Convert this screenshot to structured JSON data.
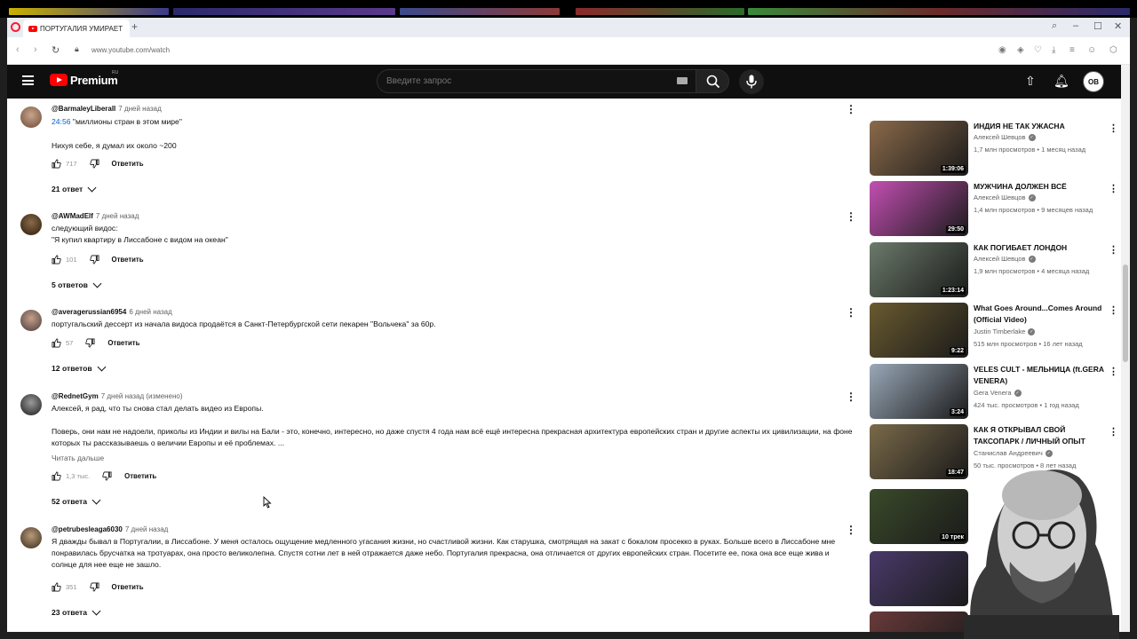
{
  "browser": {
    "tab_title": "ПОРТУГАЛИЯ УМИРАЕТ",
    "new_tab": "+",
    "url": "www.youtube.com/watch"
  },
  "header": {
    "logo_text": "Premium",
    "region": "RU",
    "search_placeholder": "Введите запрос",
    "avatar_initials": "ОВ"
  },
  "comments": [
    {
      "author": "@BarmaleyLiberall",
      "time": "7 дней назад",
      "timestamp": "24:56",
      "line1": " \"миллионы стран в этом мире\"",
      "line2": "Нихуя себе, я думал их около ~200",
      "likes": "717",
      "reply": "Ответить",
      "replies": "21 ответ"
    },
    {
      "author": "@AWMadElf",
      "time": "7 дней назад",
      "text": "следующий видос:\n\"Я купил квартиру в Лиссабоне с видом на океан\"",
      "likes": "101",
      "reply": "Ответить",
      "replies": "5 ответов"
    },
    {
      "author": "@averagerussian6954",
      "time": "6 дней назад",
      "text": "португальский дессерт из начала видоса продаётся в Санкт-Петербургской сети пекарен \"Вольчека\" за 60р.",
      "likes": "57",
      "reply": "Ответить",
      "replies": "12 ответов"
    },
    {
      "author": "@RednetGym",
      "time": "7 дней назад (изменено)",
      "text": "Алексей, я рад, что ты снова стал делать видео из Европы.\n\nПоверь, они нам не надоели, приколы из Индии и вилы на Бали - это, конечно, интересно, но даже спустя 4 года нам всё ещё интересна прекрасная архитектура европейских стран и другие аспекты их цивилизации, на фоне которых ты рассказываешь о величии Европы и её проблемах. ...",
      "more": "Читать дальше",
      "likes": "1,3 тыс.",
      "reply": "Ответить",
      "replies": "52 ответа"
    },
    {
      "author": "@petrubesleaga6030",
      "time": "7 дней назад",
      "text": "Я дважды бывал в Португалии, в Лиссабоне. У меня осталось ощущение медленного угасания жизни, но счастливой жизни. Как старушка, смотрящая на закат с бокалом просекко в руках. Больше всего в Лиссабоне мне понравилась брусчатка на тротуарах, она просто великолепна. Спустя сотни лет в ней отражается даже небо. Португалия прекрасна, она отличается от других европейских стран. Посетите ее, пока она все еще жива и солнце для нее еще не зашло.",
      "likes": "351",
      "reply": "Ответить",
      "replies": "23 ответа"
    }
  ],
  "recommended": [
    {
      "title": "ИНДИЯ НЕ ТАК УЖАСНА",
      "channel": "Алексей Шевцов",
      "meta": "1,7 млн просмотров • 1 месяц назад",
      "duration": "1:39:06",
      "color": "#8a6a4a"
    },
    {
      "title": "МУЖЧИНА ДОЛЖЕН ВСЁ",
      "channel": "Алексей Шевцов",
      "meta": "1,4 млн просмотров • 9 месяцев назад",
      "duration": "29:50",
      "color": "#c34fb2"
    },
    {
      "title": "КАК ПОГИБАЕТ ЛОНДОН",
      "channel": "Алексей Шевцов",
      "meta": "1,9 млн просмотров • 4 месяца назад",
      "duration": "1:23:14",
      "color": "#6b7a6a"
    },
    {
      "title": "What Goes Around...Comes Around (Official Video)",
      "channel": "Justin Timberlake",
      "meta": "515 млн просмотров • 16 лет назад",
      "duration": "9:22",
      "color": "#6a5a30"
    },
    {
      "title": "VELES CULT - МЕЛЬНИЦА (ft.GERA VENERA)",
      "channel": "Gera Venera",
      "meta": "424 тыс. просмотров • 1 год назад",
      "duration": "3:24",
      "color": "#9aa8b8"
    },
    {
      "title": "КАК Я ОТКРЫВАЛ СВОЙ ТАКСОПАРК / ЛИЧНЫЙ ОПЫТ",
      "channel": "Станислав Андреевич",
      "meta": "50 тыс. просмотров • 8 лет назад",
      "duration": "18:47",
      "color": "#7a6a4a"
    },
    {
      "title": "",
      "channel": "",
      "meta": "",
      "duration": "10 трек",
      "color": "#3a4a2a"
    },
    {
      "title": "",
      "channel": "",
      "meta": "",
      "duration": "",
      "color": "#4a3a6a"
    },
    {
      "title": "",
      "channel": "",
      "meta": "",
      "duration": "",
      "color": "#6a3a3a"
    }
  ],
  "icons": {
    "like": "thumb-up-icon",
    "dislike": "thumb-down-icon",
    "more": "more-vertical-icon"
  }
}
